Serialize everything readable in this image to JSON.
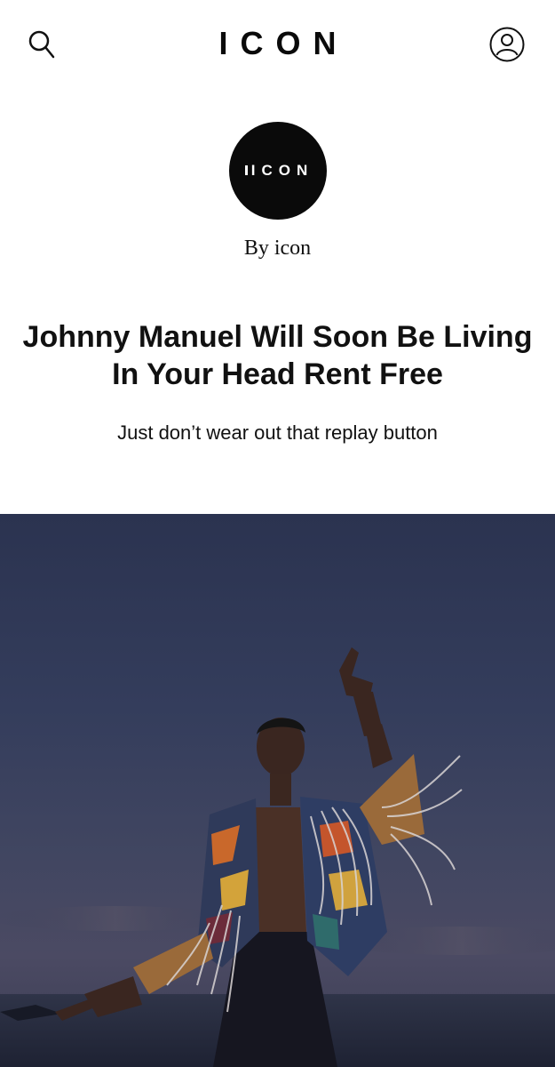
{
  "header": {
    "brand": "ICON",
    "search_icon": "search-icon",
    "account_icon": "user-circle-icon"
  },
  "publication": {
    "logo_text": "ICON",
    "byline": "By icon"
  },
  "article": {
    "headline": "Johnny Manuel Will Soon Be Living In Your Head Rent Free",
    "dek": "Just don’t wear out that replay button"
  },
  "colors": {
    "background": "#ffffff",
    "text": "#111111",
    "logo_circle": "#0a0a0a",
    "hero_sky": "#343d5c"
  }
}
